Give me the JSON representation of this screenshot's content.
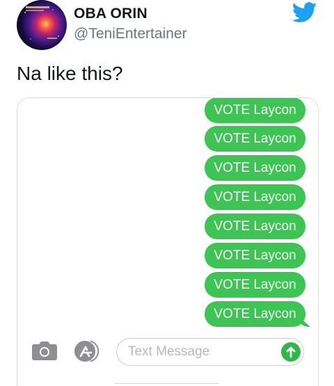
{
  "author": {
    "display_name": "OBA ORIN",
    "handle": "@TeniEntertainer",
    "avatar_icon": "album-art-avatar"
  },
  "brand_icon": "twitter-bird-icon",
  "brand_color": "#1da1f2",
  "tweet": {
    "text": "Na like this?"
  },
  "imessage": {
    "bubble_color": "#3cc552",
    "messages": [
      "VOTE Laycon",
      "VOTE Laycon",
      "VOTE Laycon",
      "VOTE Laycon",
      "VOTE Laycon",
      "VOTE Laycon",
      "VOTE Laycon",
      "VOTE Laycon"
    ],
    "input": {
      "placeholder": "Text Message"
    },
    "icons": {
      "camera": "camera-icon",
      "app_store": "app-store-icon",
      "send": "send-arrow-icon"
    }
  }
}
